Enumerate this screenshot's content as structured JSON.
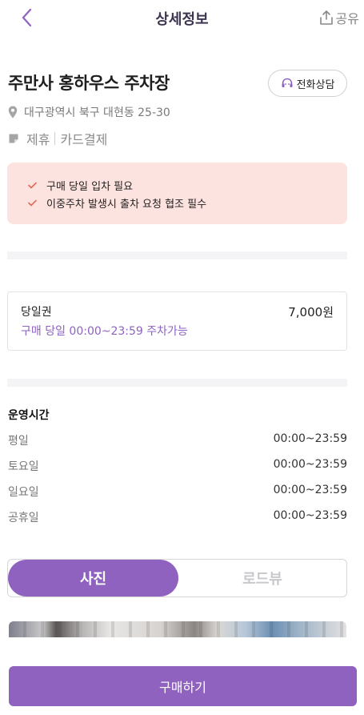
{
  "header": {
    "title": "상세정보",
    "share_label": "공유"
  },
  "place": {
    "name": "주만사 홍하우스 주차장",
    "call_label": "전화상담",
    "address": "대구광역시 북구 대현동 25-30",
    "tags": [
      "제휴",
      "카드결제"
    ]
  },
  "notices": [
    "구매 당일 입차 필요",
    "이중주차 발생시 출차 요청 협조 필수"
  ],
  "ticket": {
    "name": "당일권",
    "price": "7,000원",
    "description": "구매 당일 00:00~23:59 주차가능"
  },
  "hours": {
    "title": "운영시간",
    "rows": [
      {
        "day": "평일",
        "time": "00:00~23:59"
      },
      {
        "day": "토요일",
        "time": "00:00~23:59"
      },
      {
        "day": "일요일",
        "time": "00:00~23:59"
      },
      {
        "day": "공휴일",
        "time": "00:00~23:59"
      }
    ]
  },
  "view_toggle": {
    "photo_label": "사진",
    "roadview_label": "로드뷰",
    "selected": "사진"
  },
  "footer": {
    "buy_label": "구매하기"
  },
  "colors": {
    "accent": "#8f62bf",
    "notice_bg": "#fde3df",
    "check": "#e06a55"
  },
  "icons": {
    "back": "chevron-left-icon",
    "share": "share-icon",
    "call": "headset-icon",
    "location": "location-pin-icon",
    "tag": "tag-icon",
    "check": "check-icon"
  }
}
